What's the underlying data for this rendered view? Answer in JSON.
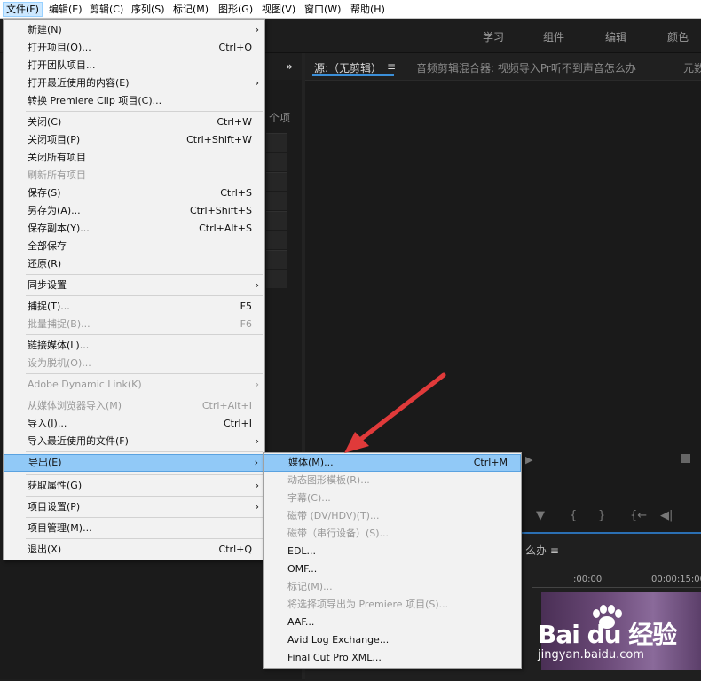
{
  "menubar": {
    "items": [
      "文件(F)",
      "编辑(E)",
      "剪辑(C)",
      "序列(S)",
      "标记(M)",
      "图形(G)",
      "视图(V)",
      "窗口(W)",
      "帮助(H)"
    ]
  },
  "workspace": {
    "tabs": [
      "学习",
      "组件",
      "编辑",
      "颜色"
    ]
  },
  "left_panel": {
    "label": "个项",
    "collapse": "»"
  },
  "source_monitor": {
    "tab_source": "源:（无剪辑）",
    "tab_menu": "≡",
    "tab_mixer": "音频剪辑混合器: 视频导入Pr听不到声音怎么办",
    "tab_extra": "元数",
    "controls": [
      "▼",
      "{",
      "}",
      "{←",
      "◀|"
    ]
  },
  "timeline": {
    "title": "么办 ≡",
    "timecode_1": ":00:00",
    "timecode_2": "00:00:15:00"
  },
  "file_menu": {
    "items": [
      {
        "label": "新建(N)",
        "shortcut": "",
        "arrow": "›",
        "disabled": false
      },
      {
        "label": "打开项目(O)...",
        "shortcut": "Ctrl+O",
        "arrow": "",
        "disabled": false
      },
      {
        "label": "打开团队项目...",
        "shortcut": "",
        "arrow": "",
        "disabled": false
      },
      {
        "label": "打开最近使用的内容(E)",
        "shortcut": "",
        "arrow": "›",
        "disabled": false
      },
      {
        "label": "转换 Premiere Clip 项目(C)...",
        "shortcut": "",
        "arrow": "",
        "disabled": false
      },
      {
        "label": "关闭(C)",
        "shortcut": "Ctrl+W",
        "arrow": "",
        "disabled": false
      },
      {
        "label": "关闭项目(P)",
        "shortcut": "Ctrl+Shift+W",
        "arrow": "",
        "disabled": false
      },
      {
        "label": "关闭所有项目",
        "shortcut": "",
        "arrow": "",
        "disabled": false
      },
      {
        "label": "刷新所有项目",
        "shortcut": "",
        "arrow": "",
        "disabled": true
      },
      {
        "label": "保存(S)",
        "shortcut": "Ctrl+S",
        "arrow": "",
        "disabled": false
      },
      {
        "label": "另存为(A)...",
        "shortcut": "Ctrl+Shift+S",
        "arrow": "",
        "disabled": false
      },
      {
        "label": "保存副本(Y)...",
        "shortcut": "Ctrl+Alt+S",
        "arrow": "",
        "disabled": false
      },
      {
        "label": "全部保存",
        "shortcut": "",
        "arrow": "",
        "disabled": false
      },
      {
        "label": "还原(R)",
        "shortcut": "",
        "arrow": "",
        "disabled": false
      },
      {
        "label": "同步设置",
        "shortcut": "",
        "arrow": "›",
        "disabled": false
      },
      {
        "label": "捕捉(T)...",
        "shortcut": "F5",
        "arrow": "",
        "disabled": false
      },
      {
        "label": "批量捕捉(B)...",
        "shortcut": "F6",
        "arrow": "",
        "disabled": true
      },
      {
        "label": "链接媒体(L)...",
        "shortcut": "",
        "arrow": "",
        "disabled": false
      },
      {
        "label": "设为脱机(O)...",
        "shortcut": "",
        "arrow": "",
        "disabled": true
      },
      {
        "label": "Adobe Dynamic Link(K)",
        "shortcut": "",
        "arrow": "›",
        "disabled": true
      },
      {
        "label": "从媒体浏览器导入(M)",
        "shortcut": "Ctrl+Alt+I",
        "arrow": "",
        "disabled": true
      },
      {
        "label": "导入(I)...",
        "shortcut": "Ctrl+I",
        "arrow": "",
        "disabled": false
      },
      {
        "label": "导入最近使用的文件(F)",
        "shortcut": "",
        "arrow": "›",
        "disabled": false
      },
      {
        "label": "导出(E)",
        "shortcut": "",
        "arrow": "›",
        "disabled": false,
        "highlight": true
      },
      {
        "label": "获取属性(G)",
        "shortcut": "",
        "arrow": "›",
        "disabled": false
      },
      {
        "label": "项目设置(P)",
        "shortcut": "",
        "arrow": "›",
        "disabled": false
      },
      {
        "label": "项目管理(M)...",
        "shortcut": "",
        "arrow": "",
        "disabled": false
      },
      {
        "label": "退出(X)",
        "shortcut": "Ctrl+Q",
        "arrow": "",
        "disabled": false
      }
    ]
  },
  "export_submenu": {
    "items": [
      {
        "label": "媒体(M)...",
        "shortcut": "Ctrl+M",
        "disabled": false,
        "highlight": true
      },
      {
        "label": "动态图形模板(R)...",
        "shortcut": "",
        "disabled": true
      },
      {
        "label": "字幕(C)...",
        "shortcut": "",
        "disabled": true
      },
      {
        "label": "磁带 (DV/HDV)(T)...",
        "shortcut": "",
        "disabled": true
      },
      {
        "label": "磁带（串行设备）(S)...",
        "shortcut": "",
        "disabled": true
      },
      {
        "label": "EDL...",
        "shortcut": "",
        "disabled": false
      },
      {
        "label": "OMF...",
        "shortcut": "",
        "disabled": false
      },
      {
        "label": "标记(M)...",
        "shortcut": "",
        "disabled": true
      },
      {
        "label": "将选择项导出为 Premiere 项目(S)...",
        "shortcut": "",
        "disabled": true
      },
      {
        "label": "AAF...",
        "shortcut": "",
        "disabled": false
      },
      {
        "label": "Avid Log Exchange...",
        "shortcut": "",
        "disabled": false
      },
      {
        "label": "Final Cut Pro XML...",
        "shortcut": "",
        "disabled": false
      }
    ]
  },
  "watermark": {
    "logo": "Bai du 经验",
    "url": "jingyan.baidu.com"
  },
  "colors": {
    "highlight": "#91c9f7",
    "accent_blue": "#3b8fd8",
    "arrow_red": "#e03a3a"
  }
}
